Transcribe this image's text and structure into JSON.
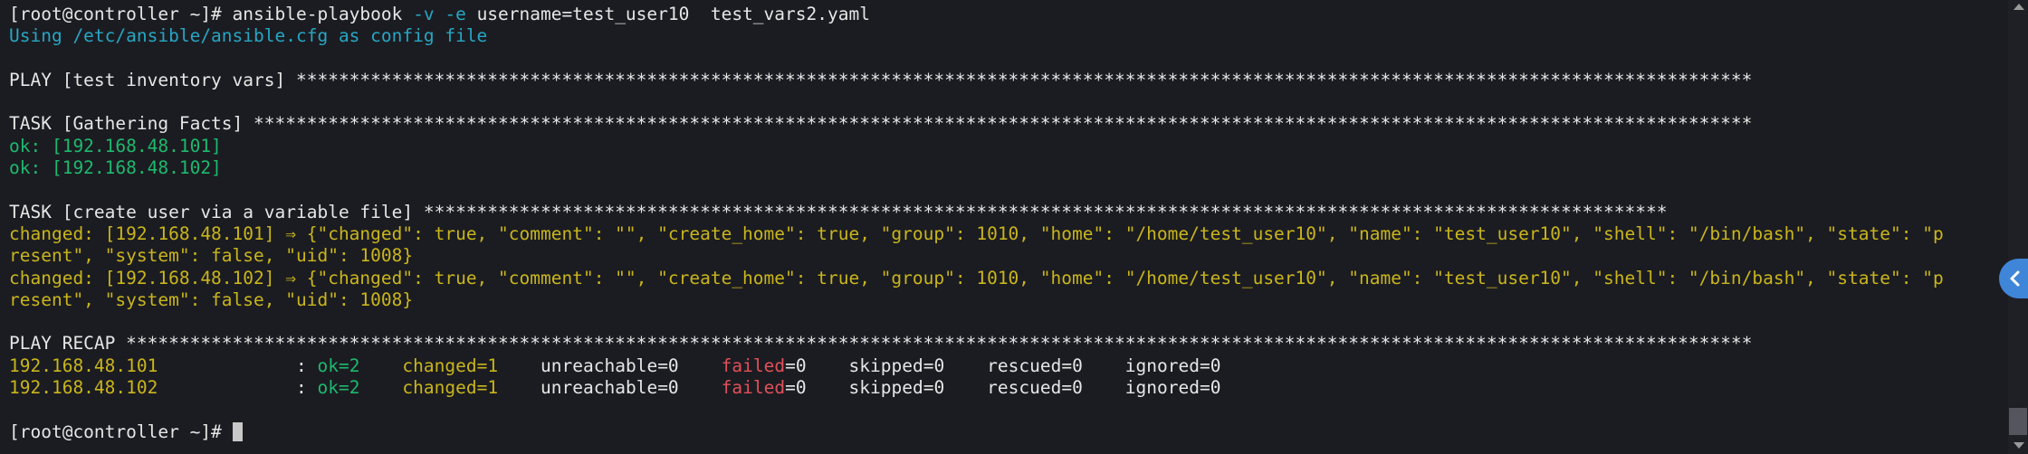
{
  "terminal": {
    "lines": [
      {
        "cls": "w",
        "parts": [
          {
            "t": "[root@controller ~]# ansible-playbook ",
            "c": "w"
          },
          {
            "t": "-v -e",
            "c": "c"
          },
          {
            "t": " username=test_user10  test_vars2.yaml",
            "c": "w"
          }
        ]
      },
      {
        "cls": "c",
        "text": "Using /etc/ansible/ansible.cfg as config file"
      },
      {
        "cls": "blank",
        "text": ""
      },
      {
        "cls": "w",
        "text": "PLAY [test inventory vars] *****************************************************************************************************************************************"
      },
      {
        "cls": "blank",
        "text": ""
      },
      {
        "cls": "w",
        "text": "TASK [Gathering Facts] *********************************************************************************************************************************************"
      },
      {
        "cls": "g",
        "text": "ok: [192.168.48.101]"
      },
      {
        "cls": "g",
        "text": "ok: [192.168.48.102]"
      },
      {
        "cls": "blank",
        "text": ""
      },
      {
        "cls": "w",
        "text": "TASK [create user via a variable file] *********************************************************************************************************************"
      },
      {
        "cls": "y",
        "text": "changed: [192.168.48.101] ⇒ {\"changed\": true, \"comment\": \"\", \"create_home\": true, \"group\": 1010, \"home\": \"/home/test_user10\", \"name\": \"test_user10\", \"shell\": \"/bin/bash\", \"state\": \"p"
      },
      {
        "cls": "y",
        "text": "resent\", \"system\": false, \"uid\": 1008}"
      },
      {
        "cls": "y",
        "text": "changed: [192.168.48.102] ⇒ {\"changed\": true, \"comment\": \"\", \"create_home\": true, \"group\": 1010, \"home\": \"/home/test_user10\", \"name\": \"test_user10\", \"shell\": \"/bin/bash\", \"state\": \"p"
      },
      {
        "cls": "y",
        "text": "resent\", \"system\": false, \"uid\": 1008}"
      },
      {
        "cls": "blank",
        "text": ""
      },
      {
        "cls": "w",
        "text": "PLAY RECAP *********************************************************************************************************************************************************"
      },
      {
        "cls": "w",
        "parts": [
          {
            "t": "192.168.48.101",
            "c": "y"
          },
          {
            "t": "             : ",
            "c": "w"
          },
          {
            "t": "ok=2",
            "c": "g"
          },
          {
            "t": "    ",
            "c": "w"
          },
          {
            "t": "changed=1",
            "c": "y"
          },
          {
            "t": "    unreachable=0    ",
            "c": "w"
          },
          {
            "t": "failed",
            "c": "r"
          },
          {
            "t": "=0    skipped=0    rescued=0    ignored=0",
            "c": "w"
          }
        ]
      },
      {
        "cls": "w",
        "parts": [
          {
            "t": "192.168.48.102",
            "c": "y"
          },
          {
            "t": "             : ",
            "c": "w"
          },
          {
            "t": "ok=2",
            "c": "g"
          },
          {
            "t": "    ",
            "c": "w"
          },
          {
            "t": "changed=1",
            "c": "y"
          },
          {
            "t": "    unreachable=0    ",
            "c": "w"
          },
          {
            "t": "failed",
            "c": "r"
          },
          {
            "t": "=0    skipped=0    rescued=0    ignored=0",
            "c": "w"
          }
        ]
      },
      {
        "cls": "blank",
        "text": ""
      }
    ],
    "prompt": "[root@controller ~]# ",
    "colors": {
      "white": "#e6e6e6",
      "cyan": "#27a6c4",
      "yellow": "#c9b51c",
      "green": "#1db96e",
      "red": "#e0505a",
      "background": "#1b1c21"
    }
  },
  "side_toggle": {
    "icon": "chevron-left-icon"
  }
}
